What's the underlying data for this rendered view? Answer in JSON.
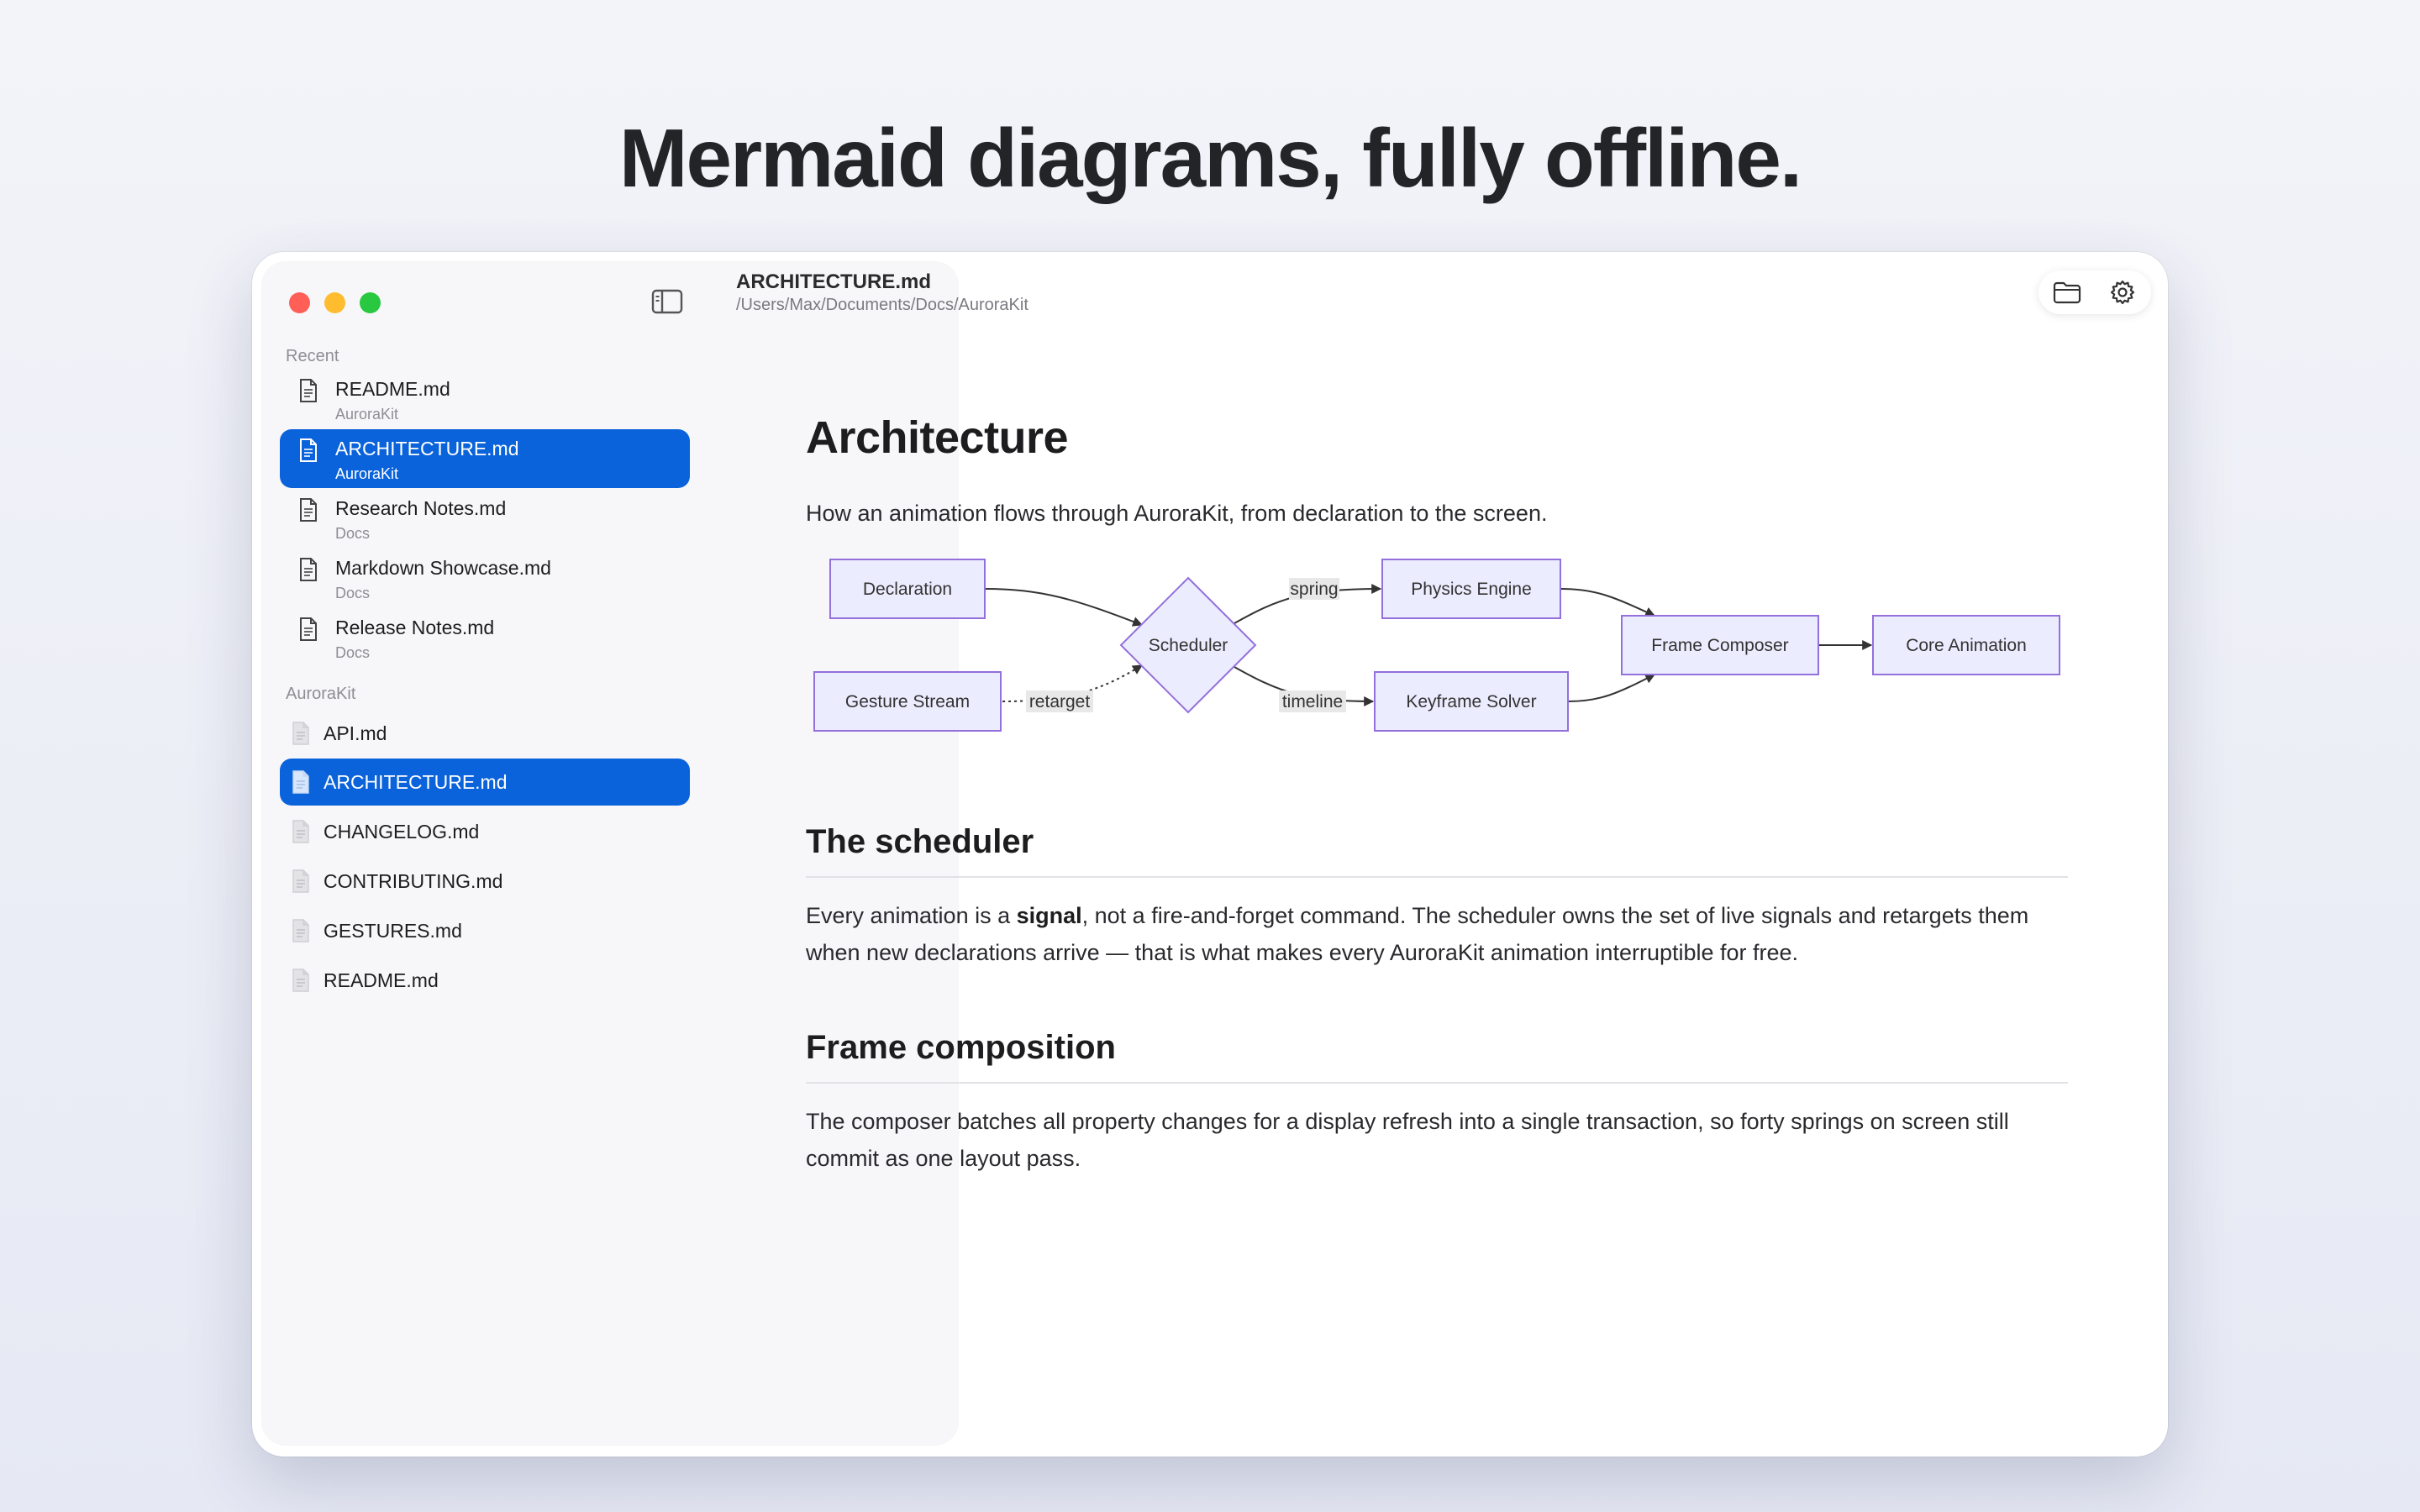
{
  "hero": {
    "title": "Mermaid diagrams, fully offline."
  },
  "sidebar": {
    "recent_label": "Recent",
    "recent": [
      {
        "name": "README.md",
        "folder": "AuroraKit",
        "selected": false
      },
      {
        "name": "ARCHITECTURE.md",
        "folder": "AuroraKit",
        "selected": true
      },
      {
        "name": "Research Notes.md",
        "folder": "Docs",
        "selected": false
      },
      {
        "name": "Markdown Showcase.md",
        "folder": "Docs",
        "selected": false
      },
      {
        "name": "Release Notes.md",
        "folder": "Docs",
        "selected": false
      }
    ],
    "folder_label": "AuroraKit",
    "files": [
      {
        "name": "API.md",
        "selected": false
      },
      {
        "name": "ARCHITECTURE.md",
        "selected": true
      },
      {
        "name": "CHANGELOG.md",
        "selected": false
      },
      {
        "name": "CONTRIBUTING.md",
        "selected": false
      },
      {
        "name": "GESTURES.md",
        "selected": false
      },
      {
        "name": "README.md",
        "selected": false
      }
    ]
  },
  "document": {
    "filename": "ARCHITECTURE.md",
    "path": "/Users/Max/Documents/Docs/AuroraKit",
    "h1": "Architecture",
    "lead": "How an animation flows through AuroraKit, from declaration to the screen.",
    "sections": [
      {
        "heading": "The scheduler",
        "text_before": "Every animation is a ",
        "bold": "signal",
        "text_after": ", not a fire-and-forget command. The scheduler owns the set of live signals and retargets them when new declarations arrive — that is what makes every AuroraKit animation interruptible for free."
      },
      {
        "heading": "Frame composition",
        "text": "The composer batches all property changes for a display refresh into a single transaction, so forty springs on screen still commit as one layout pass."
      }
    ]
  },
  "diagram": {
    "nodes": {
      "declaration": "Declaration",
      "gesture_stream": "Gesture Stream",
      "scheduler": "Scheduler",
      "physics_engine": "Physics Engine",
      "keyframe_solver": "Keyframe Solver",
      "frame_composer": "Frame Composer",
      "core_animation": "Core Animation"
    },
    "edges": {
      "retarget": "retarget",
      "spring": "spring",
      "timeline": "timeline"
    }
  },
  "colors": {
    "accent": "#0a63db",
    "node_fill": "#ececff",
    "node_stroke": "#9370db",
    "edge": "#333333"
  },
  "icons": {
    "sidebar_toggle": "sidebar-toggle-icon",
    "folder": "folder-icon",
    "settings": "gear-icon",
    "document": "document-icon"
  }
}
